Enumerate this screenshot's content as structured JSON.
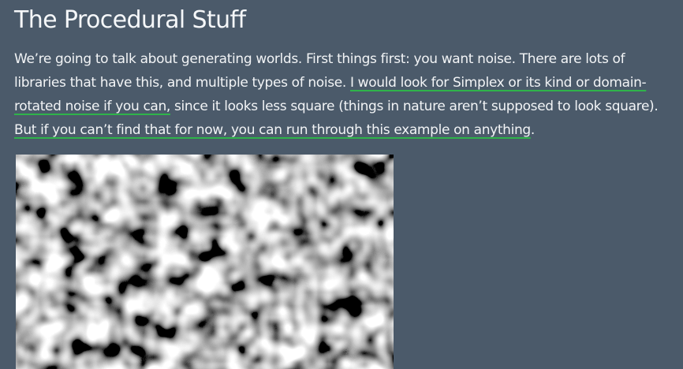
{
  "article": {
    "heading": "The Procedural Stuff",
    "intro": "We’re going to talk about generating worlds. First things first: you want noise. There are lots of libraries that have this, and multiple types of noise. ",
    "link_simplex": "I would look for Simplex or its kind or domain-rotated noise if you can,",
    "middle": " since it looks less square (things in nature aren’t supposed to look square). ",
    "link_example": "But if you can’t find that for now, you can run through this example on anything",
    "end": "."
  },
  "colors": {
    "background": "#4b5a6a",
    "text": "#f2f4f6",
    "link_underline": "#2fb34a"
  },
  "image": {
    "kind": "grayscale-noise-texture"
  }
}
